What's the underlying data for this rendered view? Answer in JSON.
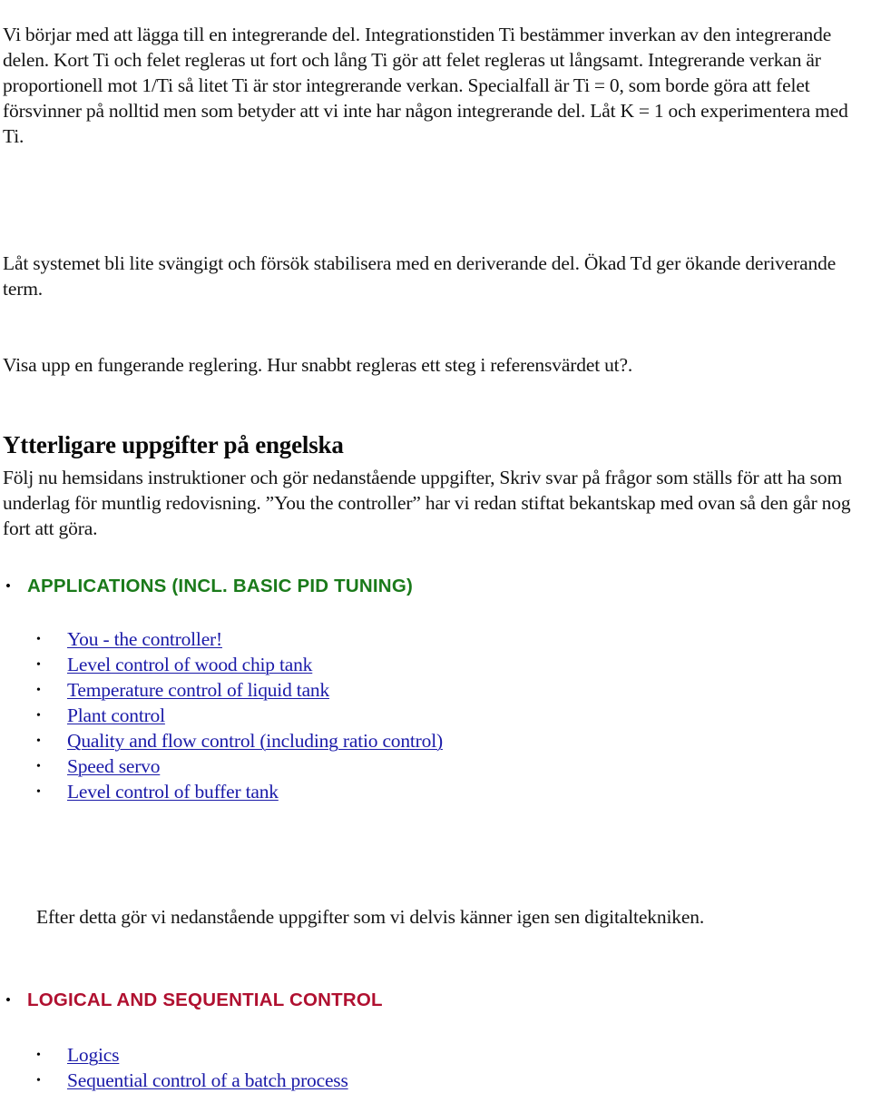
{
  "document": {
    "paragraphs": {
      "intro": "Vi börjar med att lägga till en integrerande del. Integrationstiden Ti bestämmer inverkan av den integrerande delen. Kort Ti och felet regleras ut fort och lång Ti gör att felet regleras ut långsamt. Integrerande verkan är proportionell mot 1/Ti så litet Ti är stor integrerande verkan.  Specialfall är Ti = 0, som borde göra att felet försvinner på nolltid men som betyder att vi inte har någon integrerande del.  Låt K = 1 och  experimentera med Ti.",
      "derivative": "Låt systemet bli lite svängigt och försök stabilisera med en deriverande del. Ökad Td ger ökande deriverande term.",
      "show_control": "Visa upp en fungerande reglering. Hur snabbt regleras ett steg i referensvärdet ut?.",
      "english_intro": "Följ nu hemsidans instruktioner och gör nedanstående uppgifter, Skriv svar på frågor som ställs för att ha som underlag för muntlig redovisning. ”You the controller” har vi redan stiftat bekantskap med ovan så den går nog fort att göra.",
      "after_this": "Efter detta gör vi nedanstående uppgifter som vi delvis känner igen sen digitaltekniken."
    },
    "headings": {
      "english_tasks": "Ytterligare uppgifter på engelska",
      "applications": "APPLICATIONS (INCL. BASIC PID TUNING)",
      "logical": "LOGICAL AND SEQUENTIAL CONTROL"
    },
    "bullets": {
      "disc": "•",
      "small_disc": "•"
    },
    "applications_links": [
      {
        "label": "You - the controller!"
      },
      {
        "label": "Level control of wood chip tank"
      },
      {
        "label": "Temperature control of liquid tank"
      },
      {
        "label": "Plant control"
      },
      {
        "label": "Quality and flow control (including ratio control)"
      },
      {
        "label": "Speed servo"
      },
      {
        "label": "Level control of buffer tank"
      }
    ],
    "logical_links": [
      {
        "label": "Logics"
      },
      {
        "label": "Sequential control of a batch process"
      }
    ],
    "colors": {
      "applications_heading": "#1a7a1a",
      "logical_heading": "#b01030",
      "link": "#1a1aa8",
      "body_text": "#141414",
      "background": "#ffffff"
    }
  }
}
